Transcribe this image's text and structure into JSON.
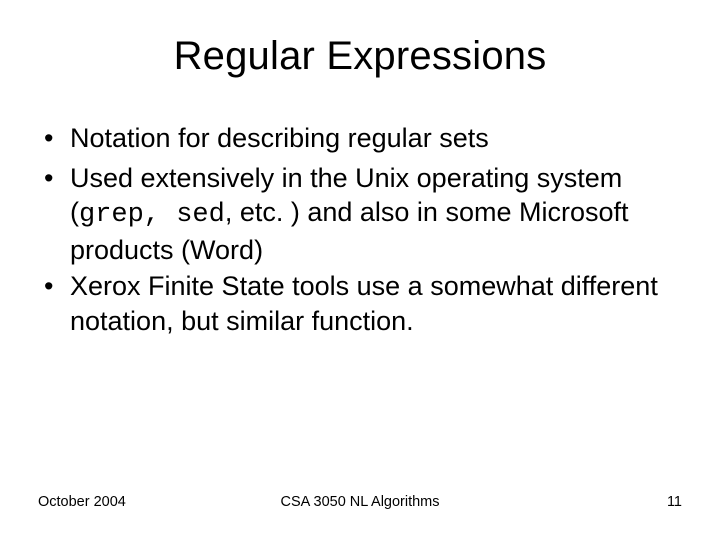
{
  "title": "Regular Expressions",
  "bullets": [
    {
      "pre": "Notation for describing regular sets",
      "mono": "",
      "post": ""
    },
    {
      "pre": "Used extensively in the Unix operating system (",
      "mono": "grep, sed",
      "post": ", etc. ) and also in some Microsoft products (Word)"
    },
    {
      "pre": "Xerox Finite State tools use a somewhat different notation, but similar function.",
      "mono": "",
      "post": ""
    }
  ],
  "footer": {
    "left": "October 2004",
    "center": "CSA 3050 NL Algorithms",
    "right": "11"
  }
}
